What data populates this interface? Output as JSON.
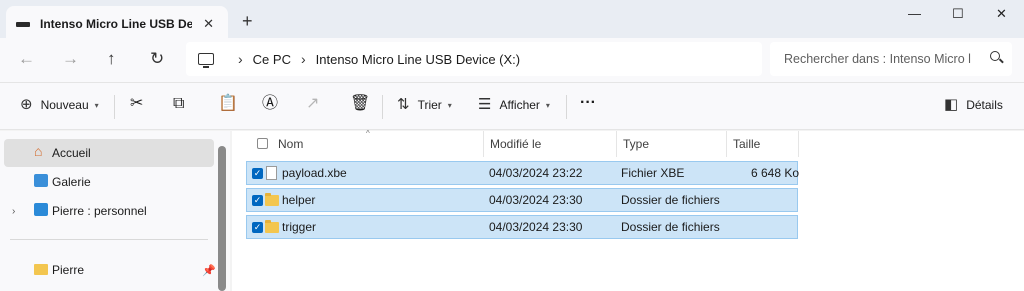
{
  "window": {
    "tab_title": "Intenso Micro Line USB Device",
    "close_tab_glyph": "✕",
    "new_tab_glyph": "+",
    "minimize_glyph": "—",
    "maximize_glyph": "☐",
    "close_glyph": "✕"
  },
  "nav": {
    "back_glyph": "←",
    "forward_glyph": "→",
    "up_glyph": "↑",
    "refresh_glyph": "↻",
    "breadcrumb": [
      "Ce PC",
      "Intenso Micro Line USB Device (X:)"
    ],
    "sep_glyph": "›",
    "search_placeholder": "Rechercher dans : Intenso Micro l"
  },
  "toolbar": {
    "new_label": "Nouveau",
    "sort_label": "Trier",
    "view_label": "Afficher",
    "more_glyph": "···",
    "details_label": "Détails"
  },
  "sidebar": {
    "items": [
      {
        "label": "Accueil",
        "icon": "home-icon"
      },
      {
        "label": "Galerie",
        "icon": "gallery-icon"
      },
      {
        "label": "Pierre : personnel",
        "icon": "cloud-folder-icon"
      },
      {
        "label": "Pierre",
        "icon": "folder-icon"
      }
    ]
  },
  "columns": [
    "Nom",
    "Modifié le",
    "Type",
    "Taille"
  ],
  "files": [
    {
      "name": "payload.xbe",
      "modified": "04/03/2024 23:22",
      "type": "Fichier XBE",
      "size": "6 648 Ko",
      "icon": "file-icon"
    },
    {
      "name": "helper",
      "modified": "04/03/2024 23:30",
      "type": "Dossier de fichiers",
      "size": "",
      "icon": "folder-icon"
    },
    {
      "name": "trigger",
      "modified": "04/03/2024 23:30",
      "type": "Dossier de fichiers",
      "size": "",
      "icon": "folder-icon"
    }
  ],
  "colors": {
    "selection_bg": "#cce4f7",
    "selection_border": "#99c9ef",
    "accent": "#0067c0"
  }
}
